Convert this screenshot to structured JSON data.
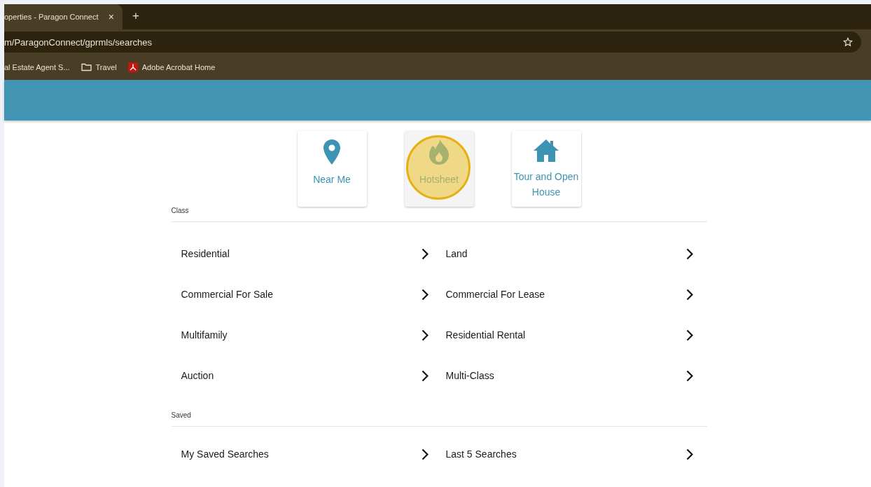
{
  "browser": {
    "tab_title": "operties - Paragon Connect",
    "tab_close": "×",
    "new_tab": "+",
    "address": "m/ParagonConnect/gprmls/searches",
    "bookmarks": [
      {
        "kind": "text",
        "label": "al Estate Agent S..."
      },
      {
        "kind": "folder",
        "label": "Travel"
      },
      {
        "kind": "pdf",
        "label": "Adobe Acrobat Home"
      }
    ]
  },
  "quick_tiles": [
    {
      "kind": "pin",
      "label": "Near Me",
      "highlighted": false
    },
    {
      "kind": "flame",
      "label": "Hotsheet",
      "highlighted": true
    },
    {
      "kind": "house",
      "label": "Tour and Open House",
      "highlighted": false
    }
  ],
  "sections": [
    {
      "title": "Class",
      "items": [
        "Residential",
        "Land",
        "Commercial For Sale",
        "Commercial For Lease",
        "Multifamily",
        "Residential Rental",
        "Auction",
        "Multi-Class"
      ]
    },
    {
      "title": "Saved",
      "items": [
        "My Saved Searches",
        "Last 5 Searches"
      ]
    }
  ]
}
